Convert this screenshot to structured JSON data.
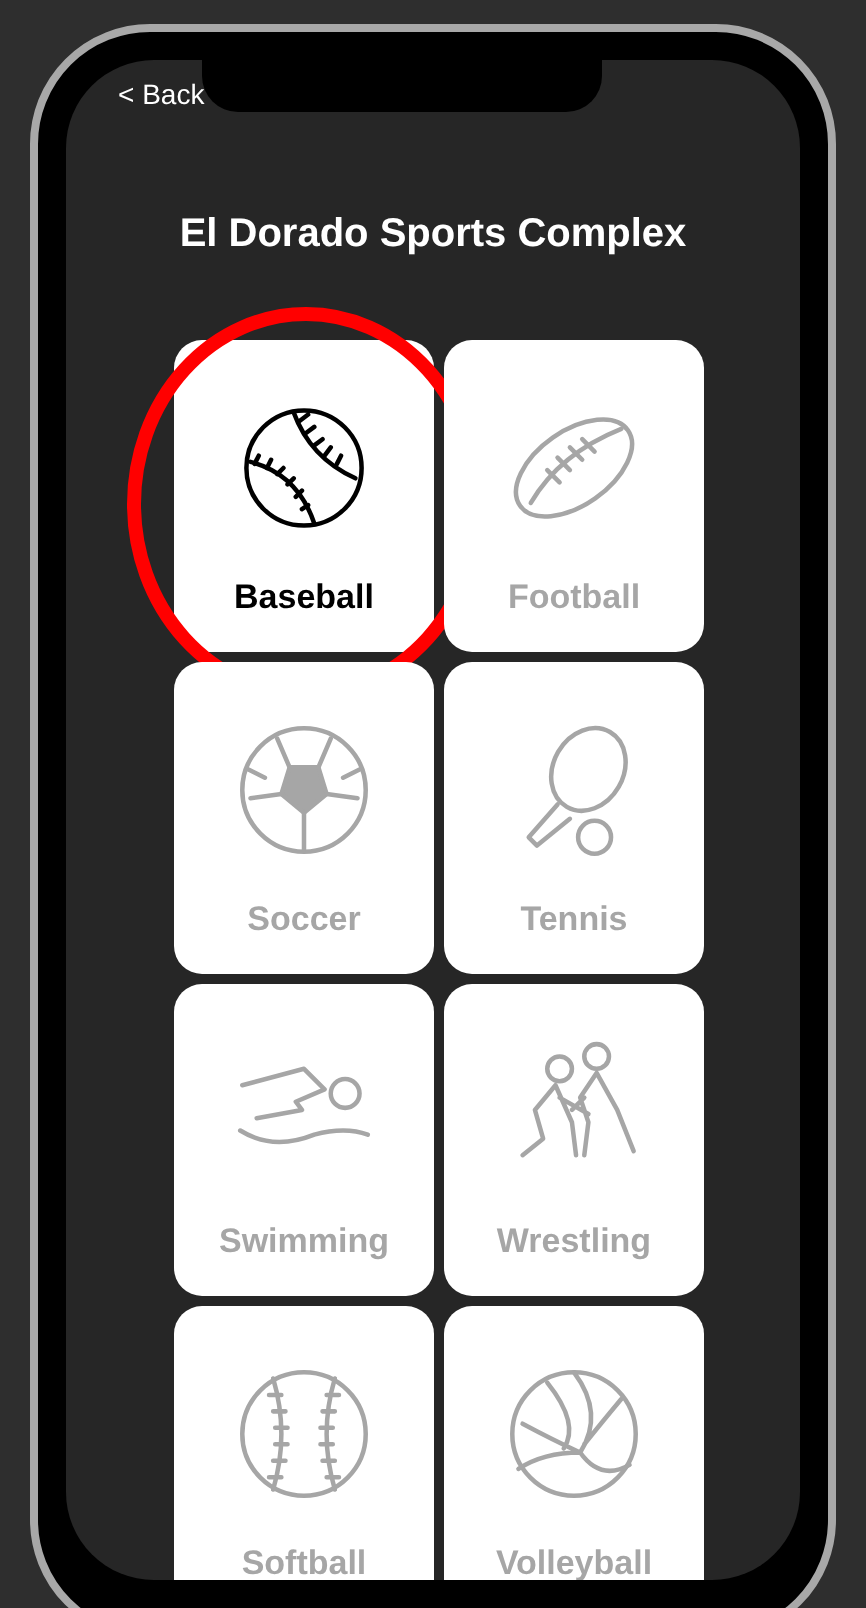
{
  "back_button": {
    "label": "< Back"
  },
  "title": "El Dorado Sports Complex",
  "sports": [
    {
      "label": "Baseball",
      "selected": true
    },
    {
      "label": "Football",
      "selected": false
    },
    {
      "label": "Soccer",
      "selected": false
    },
    {
      "label": "Tennis",
      "selected": false
    },
    {
      "label": "Swimming",
      "selected": false
    },
    {
      "label": "Wrestling",
      "selected": false
    },
    {
      "label": "Softball",
      "selected": false
    },
    {
      "label": "Volleyball",
      "selected": false
    }
  ]
}
